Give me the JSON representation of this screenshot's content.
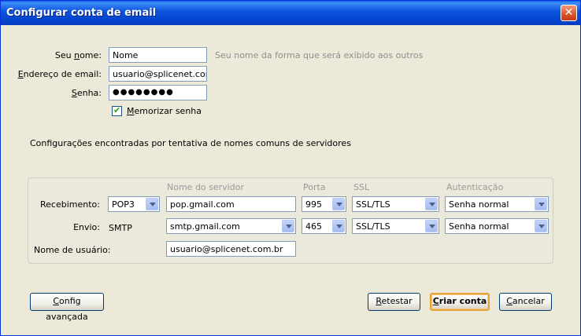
{
  "window": {
    "title": "Configurar conta de email",
    "close_label": "✕"
  },
  "form": {
    "name_label_pre": "Seu ",
    "name_label_u": "n",
    "name_label_post": "ome:",
    "name_value": "Nome",
    "name_hint": "Seu nome da forma que será exibido aos outros",
    "email_label_pre": "",
    "email_label_u": "E",
    "email_label_post": "ndereço de email:",
    "email_value": "usuario@splicenet.com.b",
    "password_label_pre": "",
    "password_label_u": "S",
    "password_label_post": "enha:",
    "password_value": "●●●●●●●●",
    "remember_label_pre": "",
    "remember_label_u": "M",
    "remember_label_post": "emorizar senha",
    "remember_checked": "✔"
  },
  "status": {
    "message": "Configurações encontradas por tentativa de nomes comuns de servidores"
  },
  "server": {
    "headers": {
      "server_name": "Nome do servidor",
      "port": "Porta",
      "ssl": "SSL",
      "auth": "Autenticação"
    },
    "incoming": {
      "label": "Recebimento:",
      "protocol": "POP3",
      "server": "pop.gmail.com",
      "port": "995",
      "ssl": "SSL/TLS",
      "auth": "Senha normal"
    },
    "outgoing": {
      "label": "Envio:",
      "protocol": "SMTP",
      "server": "smtp.gmail.com",
      "port": "465",
      "ssl": "SSL/TLS",
      "auth": "Senha normal"
    },
    "username": {
      "label": "Nome de usuário:",
      "value": "usuario@splicenet.com.br"
    }
  },
  "buttons": {
    "advanced_u": "C",
    "advanced_rest": "onfig avançada",
    "retest_u": "R",
    "retest_rest": "etestar",
    "create_u": "C",
    "create_rest": "riar conta",
    "cancel_u": "C",
    "cancel_rest": "ancelar"
  }
}
